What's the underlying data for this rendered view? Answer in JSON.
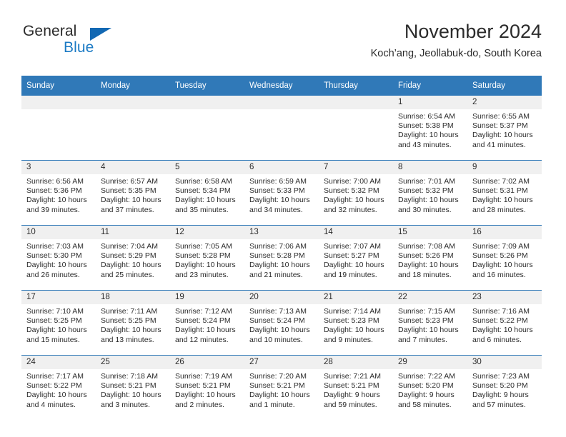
{
  "brand": {
    "name_top": "General",
    "name_bottom": "Blue",
    "triangle_color": "#1268b3",
    "blue_text_color": "#1b7ac4"
  },
  "header": {
    "title": "November 2024",
    "subtitle": "Koch’ang, Jeollabuk-do, South Korea"
  },
  "colors": {
    "header_row_bg": "#3079b8",
    "daynum_band_bg": "#f0f0f0",
    "text": "#2b2b2b"
  },
  "weekdays": [
    "Sunday",
    "Monday",
    "Tuesday",
    "Wednesday",
    "Thursday",
    "Friday",
    "Saturday"
  ],
  "weeks": [
    [
      {
        "day": "",
        "sunrise": "",
        "sunset": "",
        "daylight_a": "",
        "daylight_b": ""
      },
      {
        "day": "",
        "sunrise": "",
        "sunset": "",
        "daylight_a": "",
        "daylight_b": ""
      },
      {
        "day": "",
        "sunrise": "",
        "sunset": "",
        "daylight_a": "",
        "daylight_b": ""
      },
      {
        "day": "",
        "sunrise": "",
        "sunset": "",
        "daylight_a": "",
        "daylight_b": ""
      },
      {
        "day": "",
        "sunrise": "",
        "sunset": "",
        "daylight_a": "",
        "daylight_b": ""
      },
      {
        "day": "1",
        "sunrise": "Sunrise: 6:54 AM",
        "sunset": "Sunset: 5:38 PM",
        "daylight_a": "Daylight: 10 hours",
        "daylight_b": "and 43 minutes."
      },
      {
        "day": "2",
        "sunrise": "Sunrise: 6:55 AM",
        "sunset": "Sunset: 5:37 PM",
        "daylight_a": "Daylight: 10 hours",
        "daylight_b": "and 41 minutes."
      }
    ],
    [
      {
        "day": "3",
        "sunrise": "Sunrise: 6:56 AM",
        "sunset": "Sunset: 5:36 PM",
        "daylight_a": "Daylight: 10 hours",
        "daylight_b": "and 39 minutes."
      },
      {
        "day": "4",
        "sunrise": "Sunrise: 6:57 AM",
        "sunset": "Sunset: 5:35 PM",
        "daylight_a": "Daylight: 10 hours",
        "daylight_b": "and 37 minutes."
      },
      {
        "day": "5",
        "sunrise": "Sunrise: 6:58 AM",
        "sunset": "Sunset: 5:34 PM",
        "daylight_a": "Daylight: 10 hours",
        "daylight_b": "and 35 minutes."
      },
      {
        "day": "6",
        "sunrise": "Sunrise: 6:59 AM",
        "sunset": "Sunset: 5:33 PM",
        "daylight_a": "Daylight: 10 hours",
        "daylight_b": "and 34 minutes."
      },
      {
        "day": "7",
        "sunrise": "Sunrise: 7:00 AM",
        "sunset": "Sunset: 5:32 PM",
        "daylight_a": "Daylight: 10 hours",
        "daylight_b": "and 32 minutes."
      },
      {
        "day": "8",
        "sunrise": "Sunrise: 7:01 AM",
        "sunset": "Sunset: 5:32 PM",
        "daylight_a": "Daylight: 10 hours",
        "daylight_b": "and 30 minutes."
      },
      {
        "day": "9",
        "sunrise": "Sunrise: 7:02 AM",
        "sunset": "Sunset: 5:31 PM",
        "daylight_a": "Daylight: 10 hours",
        "daylight_b": "and 28 minutes."
      }
    ],
    [
      {
        "day": "10",
        "sunrise": "Sunrise: 7:03 AM",
        "sunset": "Sunset: 5:30 PM",
        "daylight_a": "Daylight: 10 hours",
        "daylight_b": "and 26 minutes."
      },
      {
        "day": "11",
        "sunrise": "Sunrise: 7:04 AM",
        "sunset": "Sunset: 5:29 PM",
        "daylight_a": "Daylight: 10 hours",
        "daylight_b": "and 25 minutes."
      },
      {
        "day": "12",
        "sunrise": "Sunrise: 7:05 AM",
        "sunset": "Sunset: 5:28 PM",
        "daylight_a": "Daylight: 10 hours",
        "daylight_b": "and 23 minutes."
      },
      {
        "day": "13",
        "sunrise": "Sunrise: 7:06 AM",
        "sunset": "Sunset: 5:28 PM",
        "daylight_a": "Daylight: 10 hours",
        "daylight_b": "and 21 minutes."
      },
      {
        "day": "14",
        "sunrise": "Sunrise: 7:07 AM",
        "sunset": "Sunset: 5:27 PM",
        "daylight_a": "Daylight: 10 hours",
        "daylight_b": "and 19 minutes."
      },
      {
        "day": "15",
        "sunrise": "Sunrise: 7:08 AM",
        "sunset": "Sunset: 5:26 PM",
        "daylight_a": "Daylight: 10 hours",
        "daylight_b": "and 18 minutes."
      },
      {
        "day": "16",
        "sunrise": "Sunrise: 7:09 AM",
        "sunset": "Sunset: 5:26 PM",
        "daylight_a": "Daylight: 10 hours",
        "daylight_b": "and 16 minutes."
      }
    ],
    [
      {
        "day": "17",
        "sunrise": "Sunrise: 7:10 AM",
        "sunset": "Sunset: 5:25 PM",
        "daylight_a": "Daylight: 10 hours",
        "daylight_b": "and 15 minutes."
      },
      {
        "day": "18",
        "sunrise": "Sunrise: 7:11 AM",
        "sunset": "Sunset: 5:25 PM",
        "daylight_a": "Daylight: 10 hours",
        "daylight_b": "and 13 minutes."
      },
      {
        "day": "19",
        "sunrise": "Sunrise: 7:12 AM",
        "sunset": "Sunset: 5:24 PM",
        "daylight_a": "Daylight: 10 hours",
        "daylight_b": "and 12 minutes."
      },
      {
        "day": "20",
        "sunrise": "Sunrise: 7:13 AM",
        "sunset": "Sunset: 5:24 PM",
        "daylight_a": "Daylight: 10 hours",
        "daylight_b": "and 10 minutes."
      },
      {
        "day": "21",
        "sunrise": "Sunrise: 7:14 AM",
        "sunset": "Sunset: 5:23 PM",
        "daylight_a": "Daylight: 10 hours",
        "daylight_b": "and 9 minutes."
      },
      {
        "day": "22",
        "sunrise": "Sunrise: 7:15 AM",
        "sunset": "Sunset: 5:23 PM",
        "daylight_a": "Daylight: 10 hours",
        "daylight_b": "and 7 minutes."
      },
      {
        "day": "23",
        "sunrise": "Sunrise: 7:16 AM",
        "sunset": "Sunset: 5:22 PM",
        "daylight_a": "Daylight: 10 hours",
        "daylight_b": "and 6 minutes."
      }
    ],
    [
      {
        "day": "24",
        "sunrise": "Sunrise: 7:17 AM",
        "sunset": "Sunset: 5:22 PM",
        "daylight_a": "Daylight: 10 hours",
        "daylight_b": "and 4 minutes."
      },
      {
        "day": "25",
        "sunrise": "Sunrise: 7:18 AM",
        "sunset": "Sunset: 5:21 PM",
        "daylight_a": "Daylight: 10 hours",
        "daylight_b": "and 3 minutes."
      },
      {
        "day": "26",
        "sunrise": "Sunrise: 7:19 AM",
        "sunset": "Sunset: 5:21 PM",
        "daylight_a": "Daylight: 10 hours",
        "daylight_b": "and 2 minutes."
      },
      {
        "day": "27",
        "sunrise": "Sunrise: 7:20 AM",
        "sunset": "Sunset: 5:21 PM",
        "daylight_a": "Daylight: 10 hours",
        "daylight_b": "and 1 minute."
      },
      {
        "day": "28",
        "sunrise": "Sunrise: 7:21 AM",
        "sunset": "Sunset: 5:21 PM",
        "daylight_a": "Daylight: 9 hours",
        "daylight_b": "and 59 minutes."
      },
      {
        "day": "29",
        "sunrise": "Sunrise: 7:22 AM",
        "sunset": "Sunset: 5:20 PM",
        "daylight_a": "Daylight: 9 hours",
        "daylight_b": "and 58 minutes."
      },
      {
        "day": "30",
        "sunrise": "Sunrise: 7:23 AM",
        "sunset": "Sunset: 5:20 PM",
        "daylight_a": "Daylight: 9 hours",
        "daylight_b": "and 57 minutes."
      }
    ]
  ]
}
